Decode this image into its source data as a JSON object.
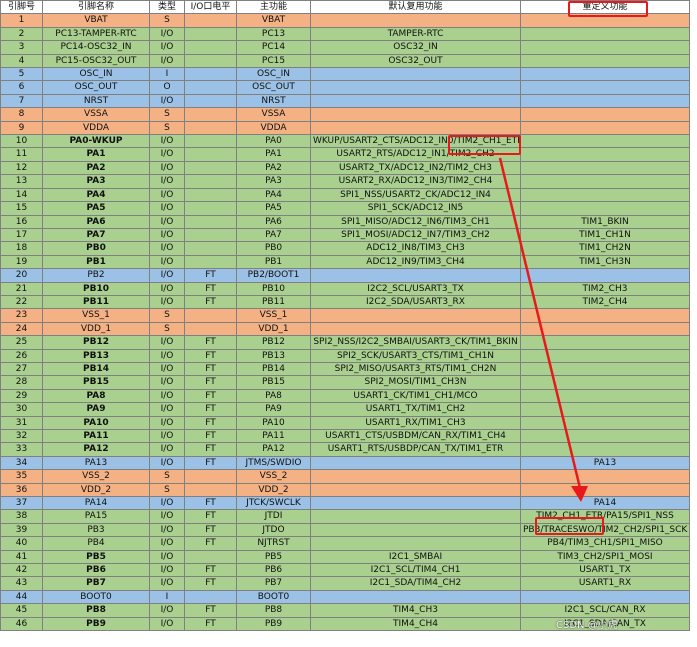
{
  "headers": [
    "引脚号",
    "引脚名称",
    "类型",
    "I/O口电平",
    "主功能",
    "默认复用功能",
    "重定义功能"
  ],
  "rows": [
    {
      "cat": "s",
      "c": [
        "1",
        "VBAT",
        "S",
        "",
        "VBAT",
        "",
        ""
      ]
    },
    {
      "cat": "io",
      "c": [
        "2",
        "PC13-TAMPER-RTC",
        "I/O",
        "",
        "PC13",
        "TAMPER-RTC",
        ""
      ]
    },
    {
      "cat": "io",
      "c": [
        "3",
        "PC14-OSC32_IN",
        "I/O",
        "",
        "PC14",
        "OSC32_IN",
        ""
      ]
    },
    {
      "cat": "io",
      "c": [
        "4",
        "PC15-OSC32_OUT",
        "I/O",
        "",
        "PC15",
        "OSC32_OUT",
        ""
      ]
    },
    {
      "cat": "blue",
      "c": [
        "5",
        "OSC_IN",
        "I",
        "",
        "OSC_IN",
        "",
        ""
      ]
    },
    {
      "cat": "blue",
      "c": [
        "6",
        "OSC_OUT",
        "O",
        "",
        "OSC_OUT",
        "",
        ""
      ]
    },
    {
      "cat": "blue",
      "c": [
        "7",
        "NRST",
        "I/O",
        "",
        "NRST",
        "",
        ""
      ]
    },
    {
      "cat": "s",
      "c": [
        "8",
        "VSSA",
        "S",
        "",
        "VSSA",
        "",
        ""
      ]
    },
    {
      "cat": "s",
      "c": [
        "9",
        "VDDA",
        "S",
        "",
        "VDDA",
        "",
        ""
      ]
    },
    {
      "cat": "io",
      "b": true,
      "c": [
        "10",
        "PA0-WKUP",
        "I/O",
        "",
        "PA0",
        "WKUP/USART2_CTS/ADC12_IN0/TIM2_CH1_ETR",
        ""
      ]
    },
    {
      "cat": "io",
      "b": true,
      "c": [
        "11",
        "PA1",
        "I/O",
        "",
        "PA1",
        "USART2_RTS/ADC12_IN1/TIM2_CH2",
        ""
      ]
    },
    {
      "cat": "io",
      "b": true,
      "c": [
        "12",
        "PA2",
        "I/O",
        "",
        "PA2",
        "USART2_TX/ADC12_IN2/TIM2_CH3",
        ""
      ]
    },
    {
      "cat": "io",
      "b": true,
      "c": [
        "13",
        "PA3",
        "I/O",
        "",
        "PA3",
        "USART2_RX/ADC12_IN3/TIM2_CH4",
        ""
      ]
    },
    {
      "cat": "io",
      "b": true,
      "c": [
        "14",
        "PA4",
        "I/O",
        "",
        "PA4",
        "SPI1_NSS/USART2_CK/ADC12_IN4",
        ""
      ]
    },
    {
      "cat": "io",
      "b": true,
      "c": [
        "15",
        "PA5",
        "I/O",
        "",
        "PA5",
        "SPI1_SCK/ADC12_IN5",
        ""
      ]
    },
    {
      "cat": "io",
      "b": true,
      "c": [
        "16",
        "PA6",
        "I/O",
        "",
        "PA6",
        "SPI1_MISO/ADC12_IN6/TIM3_CH1",
        "TIM1_BKIN"
      ]
    },
    {
      "cat": "io",
      "b": true,
      "c": [
        "17",
        "PA7",
        "I/O",
        "",
        "PA7",
        "SPI1_MOSI/ADC12_IN7/TIM3_CH2",
        "TIM1_CH1N"
      ]
    },
    {
      "cat": "io",
      "b": true,
      "c": [
        "18",
        "PB0",
        "I/O",
        "",
        "PB0",
        "ADC12_IN8/TIM3_CH3",
        "TIM1_CH2N"
      ]
    },
    {
      "cat": "io",
      "b": true,
      "c": [
        "19",
        "PB1",
        "I/O",
        "",
        "PB1",
        "ADC12_IN9/TIM3_CH4",
        "TIM1_CH3N"
      ]
    },
    {
      "cat": "blue",
      "c": [
        "20",
        "PB2",
        "I/O",
        "FT",
        "PB2/BOOT1",
        "",
        ""
      ]
    },
    {
      "cat": "io",
      "b": true,
      "c": [
        "21",
        "PB10",
        "I/O",
        "FT",
        "PB10",
        "I2C2_SCL/USART3_TX",
        "TIM2_CH3"
      ]
    },
    {
      "cat": "io",
      "b": true,
      "c": [
        "22",
        "PB11",
        "I/O",
        "FT",
        "PB11",
        "I2C2_SDA/USART3_RX",
        "TIM2_CH4"
      ]
    },
    {
      "cat": "s",
      "c": [
        "23",
        "VSS_1",
        "S",
        "",
        "VSS_1",
        "",
        ""
      ]
    },
    {
      "cat": "s",
      "c": [
        "24",
        "VDD_1",
        "S",
        "",
        "VDD_1",
        "",
        ""
      ]
    },
    {
      "cat": "io",
      "b": true,
      "c": [
        "25",
        "PB12",
        "I/O",
        "FT",
        "PB12",
        "SPI2_NSS/I2C2_SMBAI/USART3_CK/TIM1_BKIN",
        ""
      ]
    },
    {
      "cat": "io",
      "b": true,
      "c": [
        "26",
        "PB13",
        "I/O",
        "FT",
        "PB13",
        "SPI2_SCK/USART3_CTS/TIM1_CH1N",
        ""
      ]
    },
    {
      "cat": "io",
      "b": true,
      "c": [
        "27",
        "PB14",
        "I/O",
        "FT",
        "PB14",
        "SPI2_MISO/USART3_RTS/TIM1_CH2N",
        ""
      ]
    },
    {
      "cat": "io",
      "b": true,
      "c": [
        "28",
        "PB15",
        "I/O",
        "FT",
        "PB15",
        "SPI2_MOSI/TIM1_CH3N",
        ""
      ]
    },
    {
      "cat": "io",
      "b": true,
      "c": [
        "29",
        "PA8",
        "I/O",
        "FT",
        "PA8",
        "USART1_CK/TIM1_CH1/MCO",
        ""
      ]
    },
    {
      "cat": "io",
      "b": true,
      "c": [
        "30",
        "PA9",
        "I/O",
        "FT",
        "PA9",
        "USART1_TX/TIM1_CH2",
        ""
      ]
    },
    {
      "cat": "io",
      "b": true,
      "c": [
        "31",
        "PA10",
        "I/O",
        "FT",
        "PA10",
        "USART1_RX/TIM1_CH3",
        ""
      ]
    },
    {
      "cat": "io",
      "b": true,
      "c": [
        "32",
        "PA11",
        "I/O",
        "FT",
        "PA11",
        "USART1_CTS/USBDM/CAN_RX/TIM1_CH4",
        ""
      ]
    },
    {
      "cat": "io",
      "b": true,
      "c": [
        "33",
        "PA12",
        "I/O",
        "FT",
        "PA12",
        "USART1_RTS/USBDP/CAN_TX/TIM1_ETR",
        ""
      ]
    },
    {
      "cat": "blue",
      "c": [
        "34",
        "PA13",
        "I/O",
        "FT",
        "JTMS/SWDIO",
        "",
        "PA13"
      ]
    },
    {
      "cat": "s",
      "c": [
        "35",
        "VSS_2",
        "S",
        "",
        "VSS_2",
        "",
        ""
      ]
    },
    {
      "cat": "s",
      "c": [
        "36",
        "VDD_2",
        "S",
        "",
        "VDD_2",
        "",
        ""
      ]
    },
    {
      "cat": "blue",
      "c": [
        "37",
        "PA14",
        "I/O",
        "FT",
        "JTCK/SWCLK",
        "",
        "PA14"
      ]
    },
    {
      "cat": "io",
      "c": [
        "38",
        "PA15",
        "I/O",
        "FT",
        "JTDI",
        "",
        "TIM2_CH1_ETR/PA15/SPI1_NSS"
      ]
    },
    {
      "cat": "io",
      "c": [
        "39",
        "PB3",
        "I/O",
        "FT",
        "JTDO",
        "",
        "PB3/TRACESWO/TIM2_CH2/SPI1_SCK"
      ]
    },
    {
      "cat": "io",
      "c": [
        "40",
        "PB4",
        "I/O",
        "FT",
        "NJTRST",
        "",
        "PB4/TIM3_CH1/SPI1_MISO"
      ]
    },
    {
      "cat": "io",
      "b": true,
      "c": [
        "41",
        "PB5",
        "I/O",
        "",
        "PB5",
        "I2C1_SMBAI",
        "TIM3_CH2/SPI1_MOSI"
      ]
    },
    {
      "cat": "io",
      "b": true,
      "c": [
        "42",
        "PB6",
        "I/O",
        "FT",
        "PB6",
        "I2C1_SCL/TIM4_CH1",
        "USART1_TX"
      ]
    },
    {
      "cat": "io",
      "b": true,
      "c": [
        "43",
        "PB7",
        "I/O",
        "FT",
        "PB7",
        "I2C1_SDA/TIM4_CH2",
        "USART1_RX"
      ]
    },
    {
      "cat": "blue",
      "c": [
        "44",
        "BOOT0",
        "I",
        "",
        "BOOT0",
        "",
        ""
      ]
    },
    {
      "cat": "io",
      "b": true,
      "c": [
        "45",
        "PB8",
        "I/O",
        "FT",
        "PB8",
        "TIM4_CH3",
        "I2C1_SCL/CAN_RX"
      ]
    },
    {
      "cat": "io",
      "b": true,
      "c": [
        "46",
        "PB9",
        "I/O",
        "FT",
        "PB9",
        "TIM4_CH4",
        "I2C1_SDA/CAN_TX"
      ]
    }
  ],
  "colors": {
    "s": "#f4b183",
    "io": "#a9d08e",
    "blue": "#9bc2e6",
    "highlight": "#e8191b"
  },
  "watermark": "CSDN @小虎"
}
